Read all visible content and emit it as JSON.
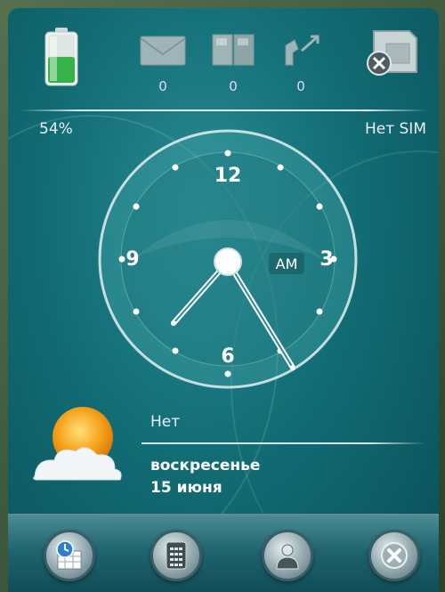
{
  "status": {
    "battery_percent": "54%",
    "battery_level": 0.54,
    "sim_status": "Нет SIM",
    "unread_messages": "0",
    "unread_voicemail": "0",
    "missed_calls": "0"
  },
  "clock": {
    "numbers": {
      "twelve": "12",
      "three": "3",
      "six": "6",
      "nine": "9"
    },
    "ampm": "AM"
  },
  "weather": {
    "text": "Нет"
  },
  "date": {
    "weekday": "воскресенье",
    "day_month": "15 июня"
  },
  "dock": {
    "items": [
      "calendar-icon",
      "phone-keypad-icon",
      "contacts-icon",
      "close-icon"
    ]
  },
  "colors": {
    "background": "#126d75",
    "dock": "#1f646e",
    "battery_fill": "#35b34a"
  }
}
